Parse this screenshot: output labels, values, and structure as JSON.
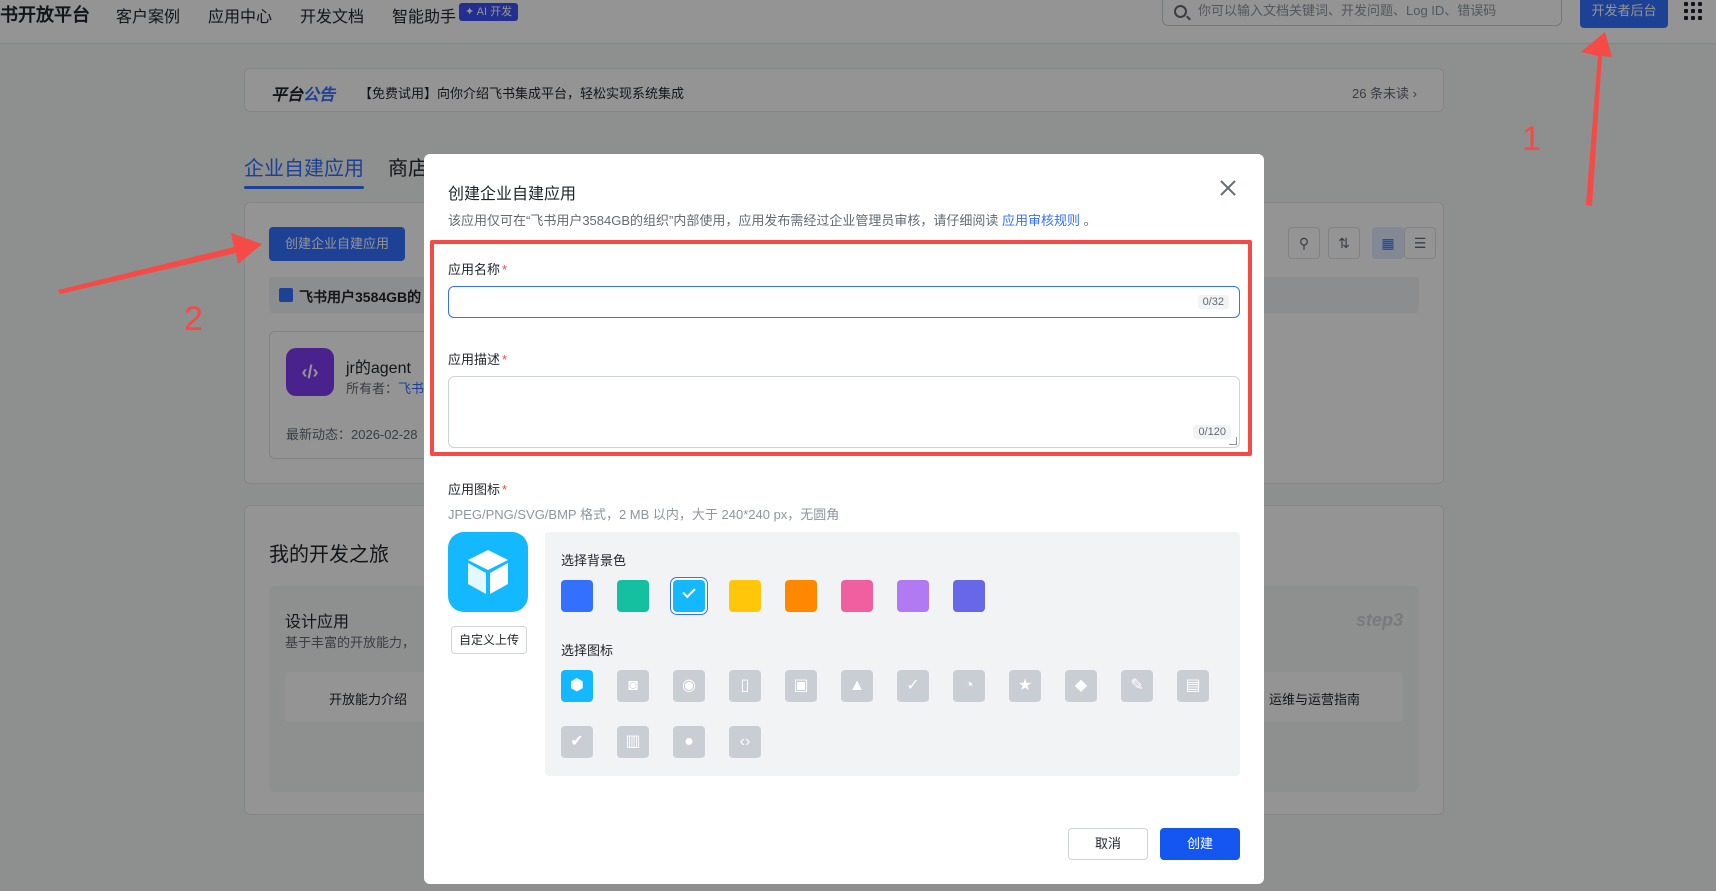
{
  "topnav": {
    "brand": "书开放平台",
    "items": [
      "客户案例",
      "应用中心",
      "开发文档",
      "智能助手"
    ],
    "ai_badge": "✦ AI 开发",
    "search_placeholder": "你可以输入文档关键词、开发问题、Log ID、错误码",
    "dev_console_button": "开发者后台"
  },
  "announcement": {
    "title_part1": "平台",
    "title_part2": "公告",
    "text": "【免费试用】向你介绍飞书集成平台，轻松实现系统集成",
    "unread": "26 条未读 ›"
  },
  "tabs": {
    "active": "企业自建应用",
    "store": "商店"
  },
  "apps_panel": {
    "create_button": "创建企业自建应用",
    "org_name": "飞书用户3584GB的",
    "tool_icons": [
      "filter-icon",
      "sort-icon",
      "grid-view-icon",
      "list-view-icon"
    ],
    "card": {
      "name": "jr的agent",
      "owner_label": "所有者：",
      "owner_value": "飞书",
      "latest": "最新动态：2026-02-28"
    }
  },
  "journey": {
    "title": "我的开发之旅",
    "step_title": "设计应用",
    "step_desc": "基于丰富的开放能力，",
    "link_left": "开放能力介绍",
    "link_right": "运维与运营指南",
    "step_watermark": "step3"
  },
  "modal": {
    "title": "创建企业自建应用",
    "description": "该应用仅可在“飞书用户3584GB的组织”内部使用，应用发布需经过企业管理员审核，请仔细阅读",
    "description_link": "应用审核规则",
    "description_end": "。",
    "name_label": "应用名称",
    "name_value": "",
    "name_counter": "0/32",
    "desc_label": "应用描述",
    "desc_value": "",
    "desc_counter": "0/120",
    "icon_label": "应用图标",
    "required_mark": "*",
    "icon_hint": "JPEG/PNG/SVG/BMP 格式，2 MB 以内，大于 240*240 px，无圆角",
    "upload_button": "自定义上传",
    "bg_color_label": "选择背景色",
    "bg_colors": [
      "#3370ff",
      "#14c0a0",
      "#14b8ff",
      "#ffc60a",
      "#ff8800",
      "#f0609e",
      "#b17af2",
      "#6668e8"
    ],
    "selected_bg_color": "#14b8ff",
    "icon_label2": "选择图标",
    "icons": [
      "cube-icon",
      "robot-icon",
      "lightbulb-icon",
      "document-icon",
      "briefcase-icon",
      "bell-icon",
      "approval-icon",
      "pie-chart-icon",
      "star-icon",
      "tag-icon",
      "wrench-icon",
      "file-icon",
      "shield-check-icon",
      "layout-icon",
      "people-icon",
      "code-icon"
    ],
    "cancel_button": "取消",
    "create_button": "创建"
  },
  "annotations": {
    "label1": "1",
    "label2": "2"
  }
}
